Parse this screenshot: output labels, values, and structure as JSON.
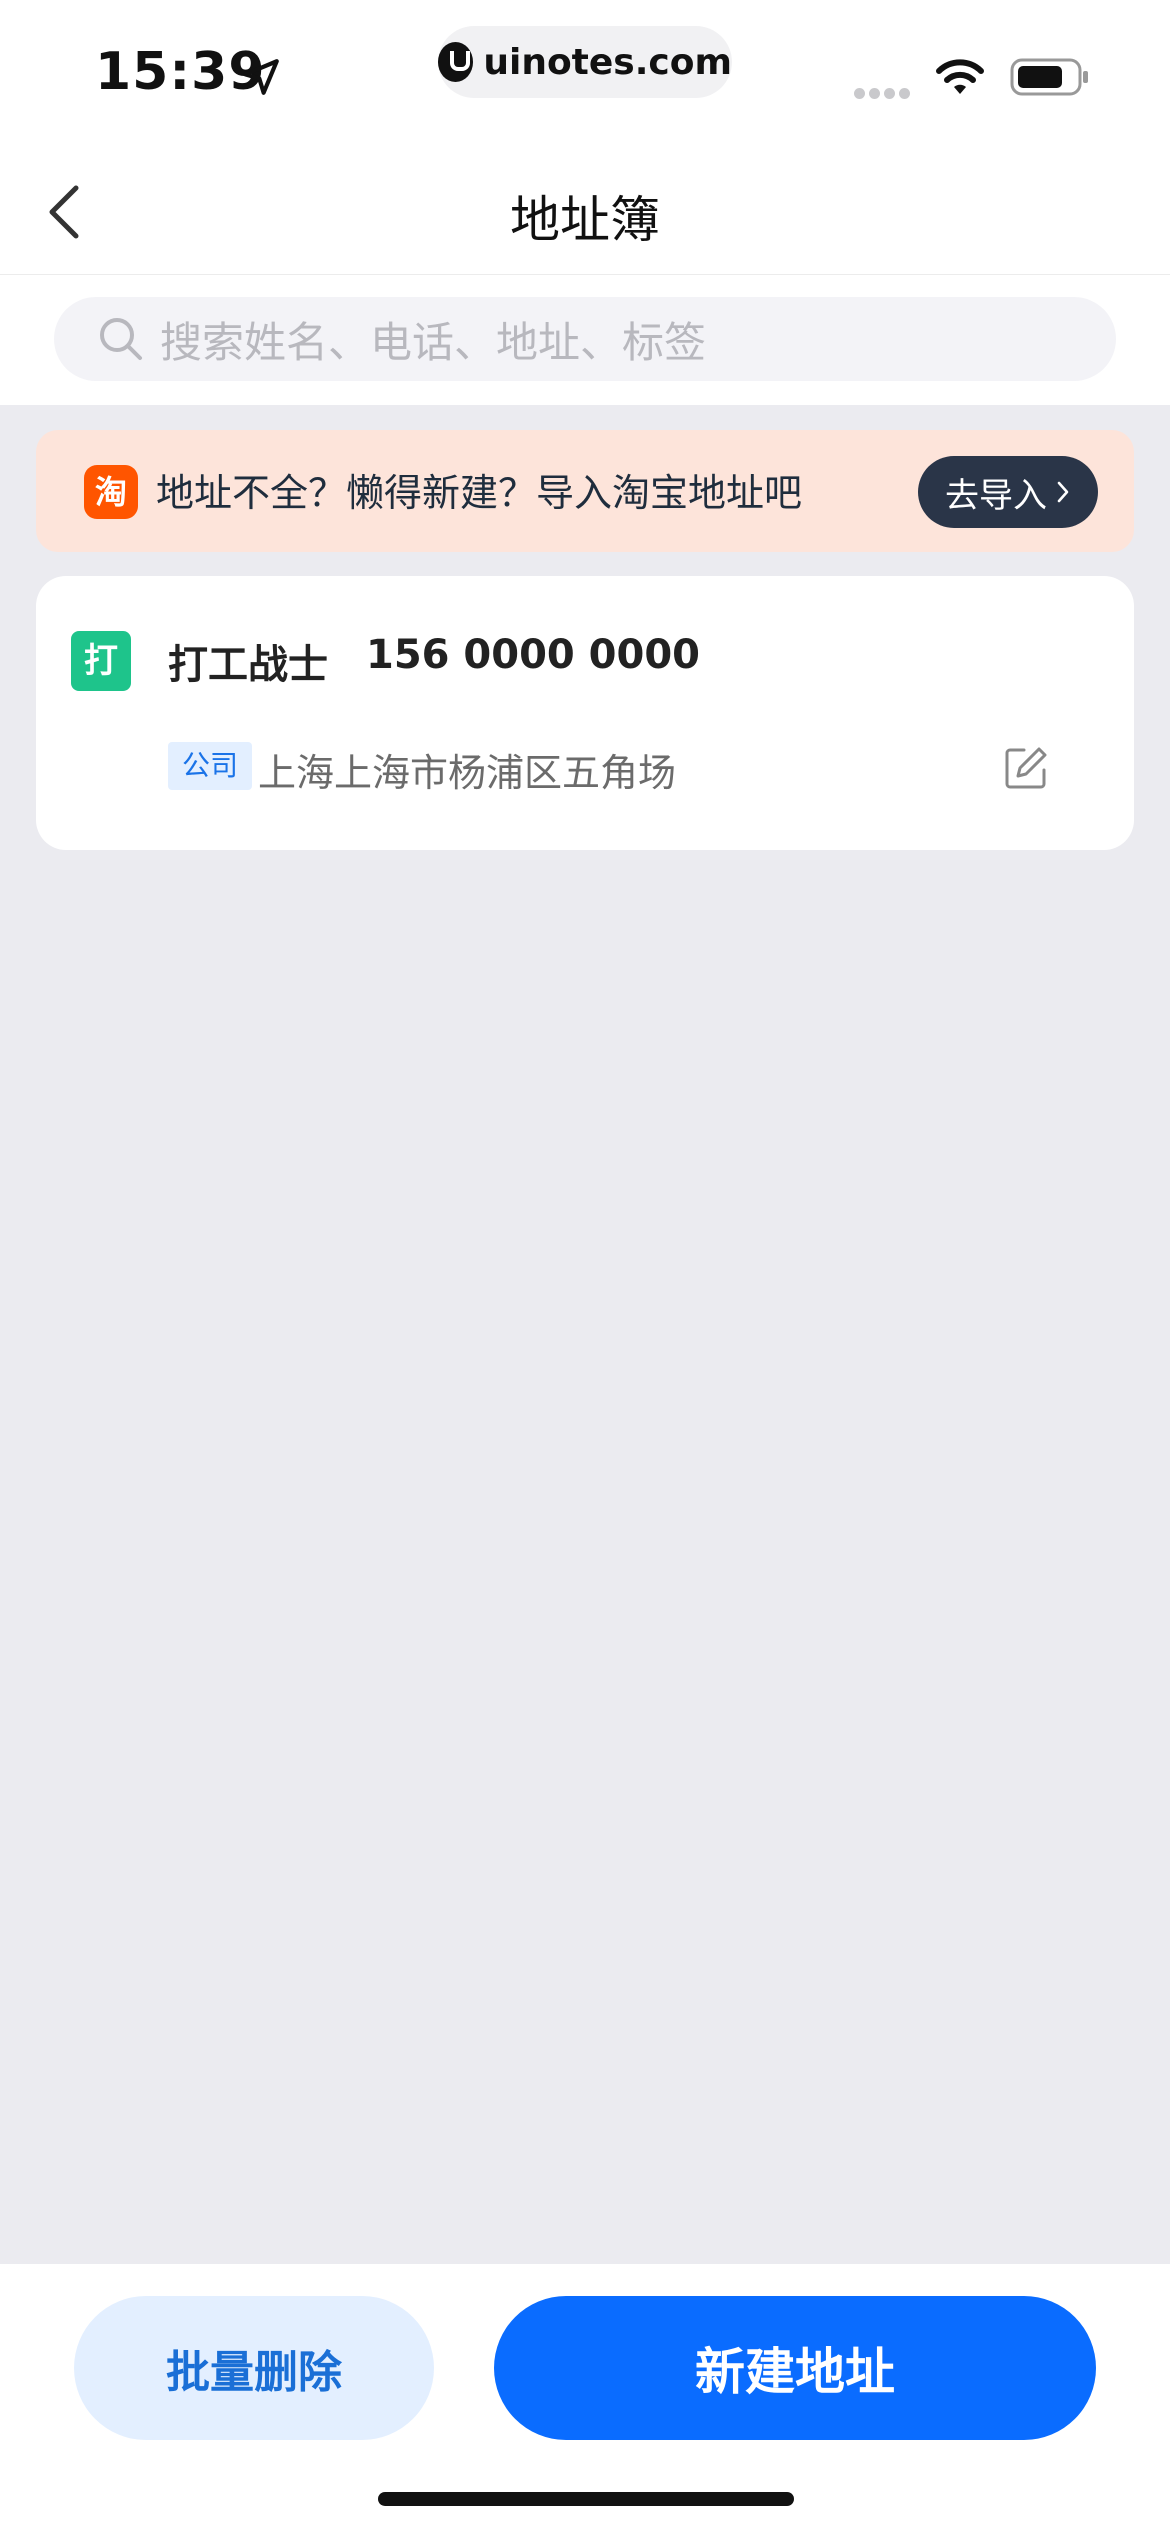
{
  "status_bar": {
    "time": "15:39",
    "url": "uinotes.com"
  },
  "nav": {
    "title": "地址簿"
  },
  "search": {
    "placeholder": "搜索姓名、电话、地址、标签"
  },
  "banner": {
    "icon_char": "淘",
    "text": "地址不全？懒得新建？导入淘宝地址吧",
    "button_label": "去导入"
  },
  "addresses": [
    {
      "avatar_char": "打",
      "name": "打工战士",
      "phone": "156 0000 0000",
      "tag": "公司",
      "address": "上海上海市杨浦区五角场"
    }
  ],
  "bottom": {
    "batch_delete_label": "批量删除",
    "new_address_label": "新建地址"
  },
  "colors": {
    "primary": "#0a6cff",
    "banner_bg": "#fde4da",
    "taobao": "#ff5500",
    "avatar": "#1ec48b",
    "page_bg": "#ebebf0"
  }
}
